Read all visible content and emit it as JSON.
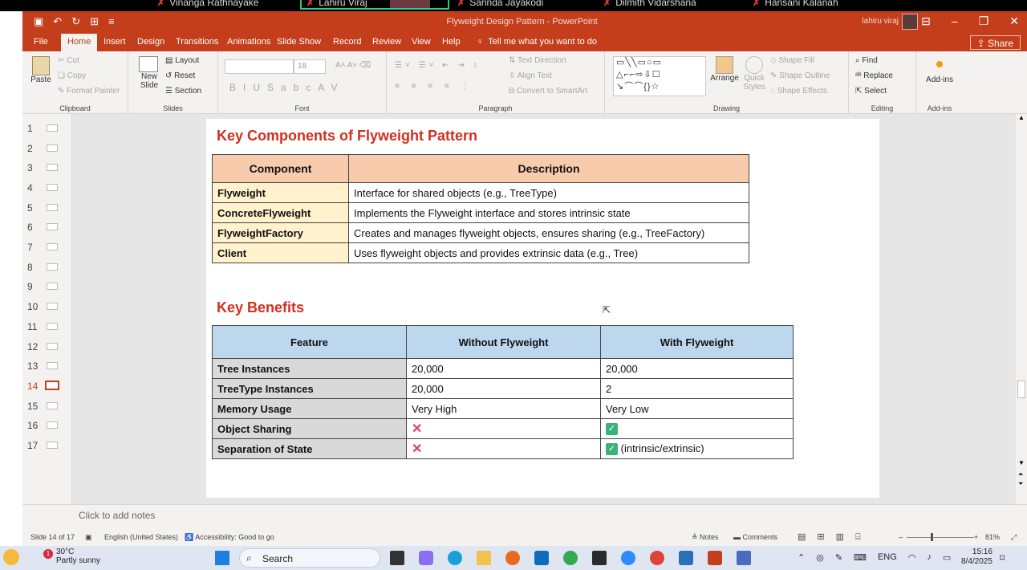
{
  "meeting_bar": {
    "participants": [
      "Vinanga Rathnayake",
      "Lahiru Viraj",
      "Sarinda Jayakodi",
      "Dilmith Vidarshana",
      "Hansani Kalanah"
    ]
  },
  "window": {
    "title": "Flyweight Design Pattern  -  PowerPoint",
    "user": "lahiru viraj",
    "share_label": "Share",
    "tell_me": "Tell me what you want to do"
  },
  "tabs": [
    "File",
    "Home",
    "Insert",
    "Design",
    "Transitions",
    "Animations",
    "Slide Show",
    "Record",
    "Review",
    "View",
    "Help"
  ],
  "ribbon": {
    "clipboard": {
      "label": "Clipboard",
      "paste": "Paste",
      "cut": "Cut",
      "copy": "Copy",
      "format_painter": "Format Painter"
    },
    "slides": {
      "label": "Slides",
      "new_slide": "New Slide",
      "layout": "Layout",
      "reset": "Reset",
      "section": "Section"
    },
    "font": {
      "label": "Font",
      "size": "18"
    },
    "paragraph": {
      "label": "Paragraph",
      "text_direction": "Text Direction",
      "align_text": "Align Text",
      "convert": "Convert to SmartArt"
    },
    "drawing": {
      "label": "Drawing",
      "arrange": "Arrange",
      "quick_styles": "Quick Styles",
      "shape_fill": "Shape Fill",
      "shape_outline": "Shape Outline",
      "shape_effects": "Shape Effects"
    },
    "editing": {
      "label": "Editing",
      "find": "Find",
      "replace": "Replace",
      "select": "Select"
    },
    "addins": {
      "label": "Add-ins",
      "button": "Add-ins"
    }
  },
  "slide_numbers": [
    "1",
    "2",
    "3",
    "4",
    "5",
    "6",
    "7",
    "8",
    "9",
    "10",
    "11",
    "12",
    "13",
    "14",
    "15",
    "16",
    "17"
  ],
  "slide": {
    "heading1": "Key Components of Flyweight Pattern",
    "table1": {
      "headers": [
        "Component",
        "Description"
      ],
      "rows": [
        [
          "Flyweight",
          "Interface for shared objects (e.g., TreeType)"
        ],
        [
          "ConcreteFlyweight",
          "Implements the Flyweight interface and stores intrinsic state"
        ],
        [
          "FlyweightFactory",
          "Creates and manages flyweight objects, ensures sharing (e.g., TreeFactory)"
        ],
        [
          "Client",
          "Uses flyweight objects and provides extrinsic data (e.g., Tree)"
        ]
      ]
    },
    "heading2": "Key Benefits",
    "table2": {
      "headers": [
        "Feature",
        "Without Flyweight",
        "With Flyweight"
      ],
      "rows": [
        [
          "Tree Instances",
          "20,000",
          "20,000"
        ],
        [
          "TreeType Instances",
          "20,000",
          "2"
        ],
        [
          "Memory Usage",
          "Very High",
          "Very Low"
        ],
        [
          "Object Sharing",
          "",
          ""
        ],
        [
          "Separation of State",
          "",
          "(intrinsic/extrinsic)"
        ]
      ]
    }
  },
  "notes_placeholder": "Click to add notes",
  "status": {
    "slide": "Slide 14 of 17",
    "language": "English (United States)",
    "accessibility": "Accessibility: Good to go",
    "notes": "Notes",
    "comments": "Comments",
    "zoom": "81%"
  },
  "taskbar": {
    "temp": "30°C",
    "weather": "Partly sunny",
    "badge": "1",
    "search": "Search",
    "lang": "ENG",
    "time": "15:16",
    "date": "8/4/2025"
  }
}
